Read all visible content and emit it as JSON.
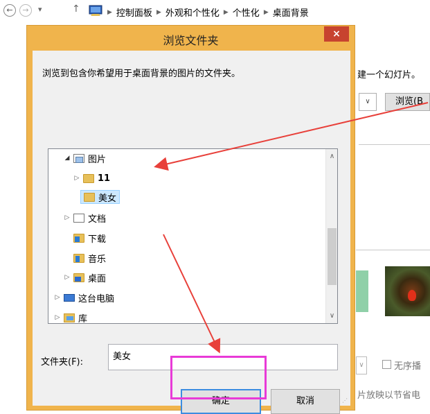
{
  "nav": {
    "back_icon": "arrow-left-circle-icon",
    "forward_icon": "arrow-right-circle-icon",
    "down": "▾",
    "up": "↑",
    "breadcrumbs": [
      "控制面板",
      "外观和个性化",
      "个性化",
      "桌面背景"
    ]
  },
  "background": {
    "slideshow_text": "建一个幻灯片。",
    "browse_label": "浏览(B",
    "shuffle_label": "无序播",
    "battery_text": "片放映以节省电"
  },
  "dialog": {
    "title": "浏览文件夹",
    "close_label": "×",
    "description": "浏览到包含你希望用于桌面背景的图片的文件夹。",
    "tree": [
      {
        "label": "图片",
        "expander": "◢",
        "icon": "pictures-folder-icon"
      },
      {
        "label": "11",
        "expander": "▷",
        "icon": "folder-icon"
      },
      {
        "label": "美女",
        "expander": "",
        "icon": "folder-icon",
        "selected": true
      },
      {
        "label": "文档",
        "expander": "▷",
        "icon": "documents-folder-icon"
      },
      {
        "label": "下载",
        "expander": "",
        "icon": "downloads-folder-icon"
      },
      {
        "label": "音乐",
        "expander": "",
        "icon": "music-folder-icon"
      },
      {
        "label": "桌面",
        "expander": "▷",
        "icon": "desktop-folder-icon"
      },
      {
        "label": "这台电脑",
        "expander": "▷",
        "icon": "computer-icon"
      },
      {
        "label": "库",
        "expander": "▷",
        "icon": "libraries-icon"
      }
    ],
    "folder_label": "文件夹(F):",
    "folder_value": "美女",
    "ok_label": "确定",
    "cancel_label": "取消"
  },
  "colors": {
    "dialog_frame": "#f0b44c",
    "close_button": "#c7432f",
    "highlight": "#e83ad7",
    "arrow": "#e8403a"
  }
}
